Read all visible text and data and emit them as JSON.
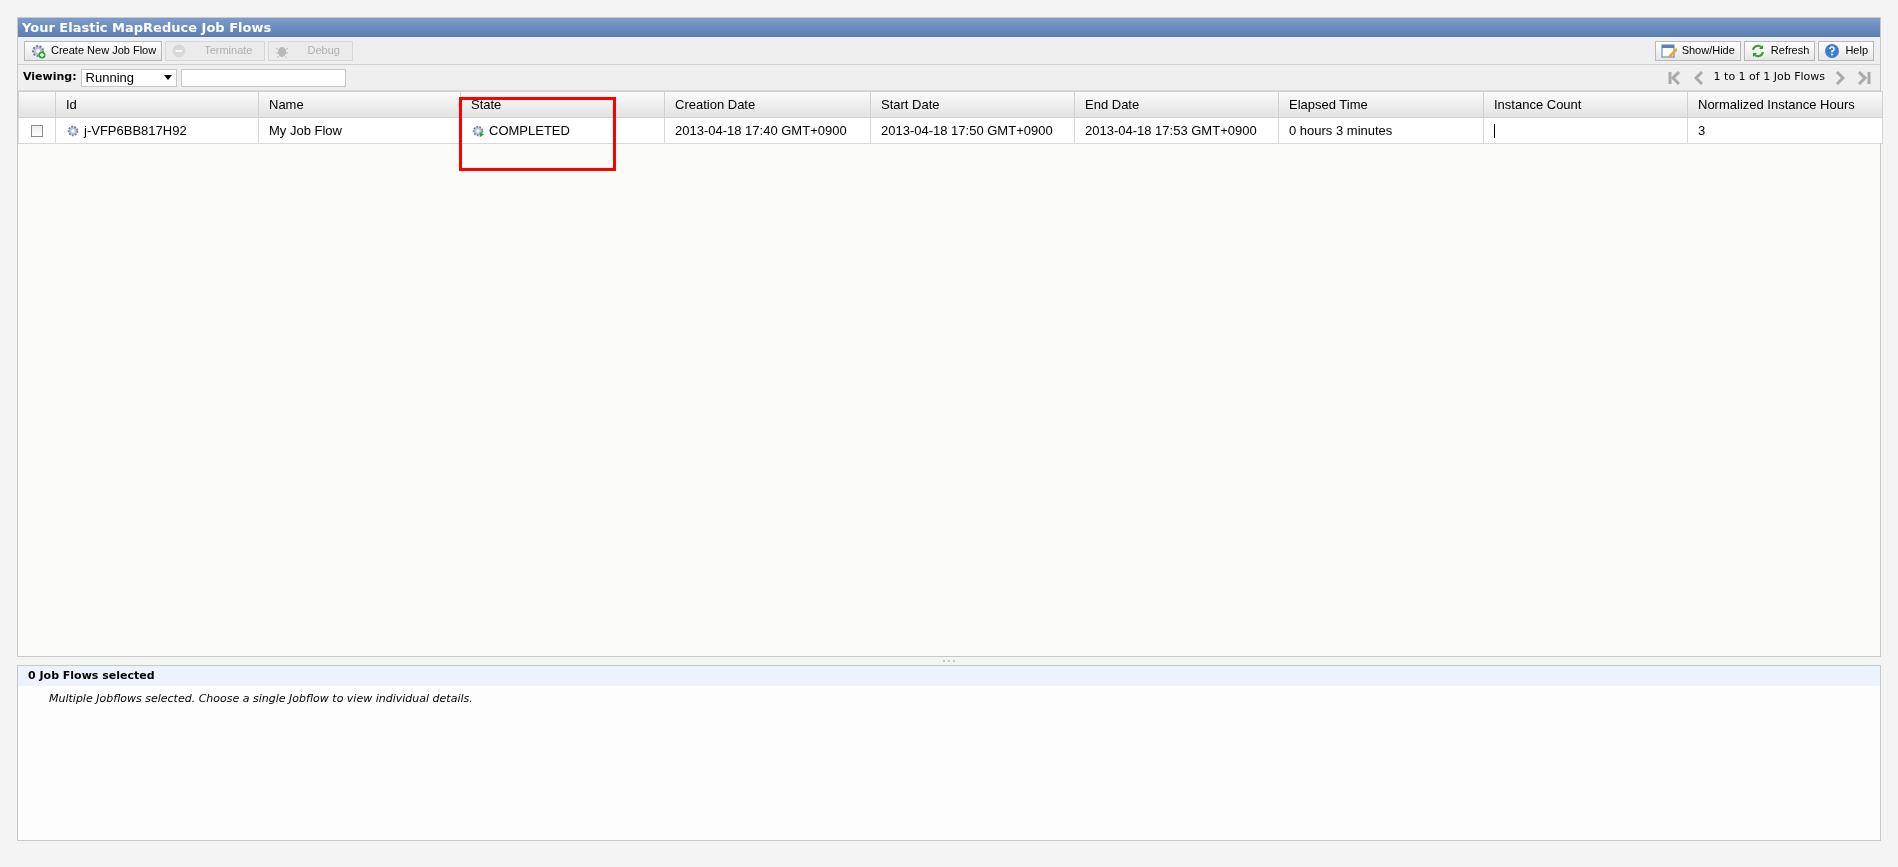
{
  "panel_title": "Your Elastic MapReduce Job Flows",
  "toolbar_left": [
    {
      "kind": "create",
      "label": "Create New Job Flow",
      "disabled": false
    },
    {
      "kind": "terminate",
      "label": "Terminate",
      "disabled": true
    },
    {
      "kind": "debug",
      "label": "Debug",
      "disabled": true
    }
  ],
  "toolbar_right": [
    {
      "kind": "showhide",
      "label": "Show/Hide",
      "disabled": false
    },
    {
      "kind": "refresh",
      "label": "Refresh",
      "disabled": false
    },
    {
      "kind": "help",
      "label": "Help",
      "disabled": false
    }
  ],
  "viewing": {
    "label": "Viewing:",
    "value": "Running"
  },
  "pagination": "1 to 1 of 1 Job Flows",
  "table": {
    "columns": [
      "Id",
      "Name",
      "State",
      "Creation Date",
      "Start Date",
      "End Date",
      "Elapsed Time",
      "Instance Count",
      "Normalized Instance Hours"
    ],
    "rows": [
      {
        "checked": false,
        "id": "j-VFP6BB817H92",
        "name": "My Job Flow",
        "state": "COMPLETED",
        "creation_date": "2013-04-18 17:40 GMT+0900",
        "start_date": "2013-04-18 17:50 GMT+0900",
        "end_date": "2013-04-18 17:53 GMT+0900",
        "elapsed_time": "0 hours 3 minutes",
        "normalized_instance_hours": "3"
      }
    ]
  },
  "details": {
    "title": "0 Job Flows selected",
    "message": "Multiple Jobflows selected. Choose a single Jobflow to view individual details."
  }
}
